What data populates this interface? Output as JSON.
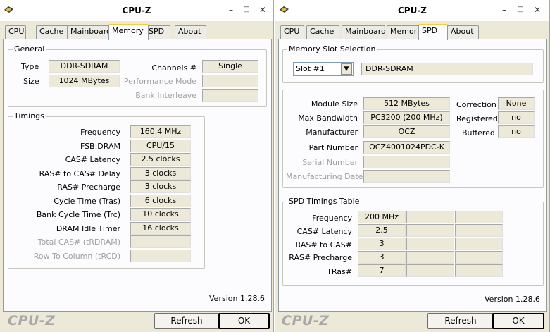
{
  "left": {
    "title": "CPU-Z",
    "tabs": [
      "CPU",
      "Cache",
      "Mainboard",
      "Memory",
      "SPD",
      "About"
    ],
    "active_tab": "Memory",
    "general": {
      "label": "General",
      "type_label": "Type",
      "type_value": "DDR-SDRAM",
      "size_label": "Size",
      "size_value": "1024 MBytes",
      "channels_label": "Channels #",
      "channels_value": "Single",
      "perf_label": "Performance Mode",
      "perf_value": "",
      "bank_label": "Bank Interleave",
      "bank_value": ""
    },
    "timings": {
      "label": "Timings",
      "rows": [
        {
          "label": "Frequency",
          "value": "160.4 MHz",
          "disabled": false
        },
        {
          "label": "FSB:DRAM",
          "value": "CPU/15",
          "disabled": false
        },
        {
          "label": "CAS# Latency",
          "value": "2.5 clocks",
          "disabled": false
        },
        {
          "label": "RAS# to CAS# Delay",
          "value": "3 clocks",
          "disabled": false
        },
        {
          "label": "RAS# Precharge",
          "value": "3 clocks",
          "disabled": false
        },
        {
          "label": "Cycle Time (Tras)",
          "value": "6 clocks",
          "disabled": false
        },
        {
          "label": "Bank Cycle Time (Trc)",
          "value": "10 clocks",
          "disabled": false
        },
        {
          "label": "DRAM Idle Timer",
          "value": "16 clocks",
          "disabled": false
        },
        {
          "label": "Total CAS# (tRDRAM)",
          "value": "",
          "disabled": true
        },
        {
          "label": "Row To Column (tRCD)",
          "value": "",
          "disabled": true
        }
      ]
    },
    "version": "Version 1.28.6",
    "footer_logo": "CPU-Z",
    "refresh_label": "Refresh",
    "ok_label": "OK"
  },
  "right": {
    "title": "CPU-Z",
    "tabs": [
      "CPU",
      "Cache",
      "Mainboard",
      "Memory",
      "SPD",
      "About"
    ],
    "active_tab": "SPD",
    "slot_selection": {
      "label": "Memory Slot Selection",
      "selected_slot": "Slot #1",
      "module_type": "DDR-SDRAM"
    },
    "module": {
      "rows": [
        {
          "label": "Module Size",
          "value": "512 MBytes",
          "disabled": false
        },
        {
          "label": "Max Bandwidth",
          "value": "PC3200 (200 MHz)",
          "disabled": false
        },
        {
          "label": "Manufacturer",
          "value": "OCZ",
          "disabled": false
        },
        {
          "label": "Part Number",
          "value": "OCZ4001024PDC-K",
          "disabled": false
        },
        {
          "label": "Serial Number",
          "value": "",
          "disabled": true
        },
        {
          "label": "Manufacturing Date",
          "value": "",
          "disabled": true
        }
      ],
      "flags": [
        {
          "label": "Correction",
          "value": "None"
        },
        {
          "label": "Registered",
          "value": "no"
        },
        {
          "label": "Buffered",
          "value": "no"
        }
      ]
    },
    "spd_timings": {
      "label": "SPD Timings Table",
      "rows": [
        {
          "label": "Frequency",
          "value": "200 MHz"
        },
        {
          "label": "CAS# Latency",
          "value": "2.5"
        },
        {
          "label": "RAS# to CAS#",
          "value": "3"
        },
        {
          "label": "RAS# Precharge",
          "value": "3"
        },
        {
          "label": "TRas#",
          "value": "7"
        }
      ]
    },
    "version": "Version 1.28.6",
    "footer_logo": "CPU-Z",
    "refresh_label": "Refresh",
    "ok_label": "OK"
  }
}
